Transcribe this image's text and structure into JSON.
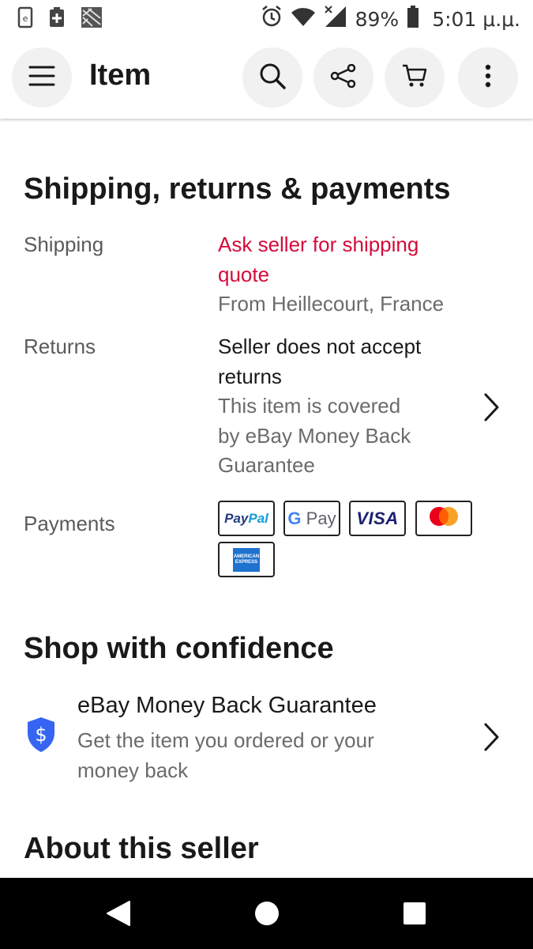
{
  "status_bar": {
    "battery": "89%",
    "time": "5:01 μ.μ."
  },
  "app_bar": {
    "title": "Item",
    "icons": [
      "menu-icon",
      "search-icon",
      "share-icon",
      "cart-icon",
      "more-vert-icon"
    ]
  },
  "shipping_section": {
    "title": "Shipping, returns & payments",
    "shipping_label": "Shipping",
    "shipping_value_lines": [
      "Ask seller for shipping",
      "quote"
    ],
    "shipping_from": "From Heillecourt, France",
    "returns_label": "Returns",
    "returns_value_lines": [
      "Seller does not accept",
      "returns"
    ],
    "returns_note_lines": [
      "This item is covered",
      "by eBay Money Back",
      "Guarantee"
    ],
    "payments_label": "Payments",
    "payment_methods": {
      "paypal_a": "Pay",
      "paypal_b": "Pal",
      "gpay_g": "G",
      "gpay_text": "Pay",
      "visa": "VISA",
      "amex_line1": "AMERICAN",
      "amex_line2": "EXPRESS"
    }
  },
  "confidence_section": {
    "title": "Shop with confidence",
    "guarantee_title": "eBay Money Back Guarantee",
    "guarantee_desc_lines": [
      "Get the item you ordered or your",
      "money back"
    ],
    "badge_symbol": "$"
  },
  "seller_section": {
    "title": "About this seller"
  },
  "colors": {
    "accent_red": "#d50b3a",
    "shield_blue": "#3665f3"
  }
}
